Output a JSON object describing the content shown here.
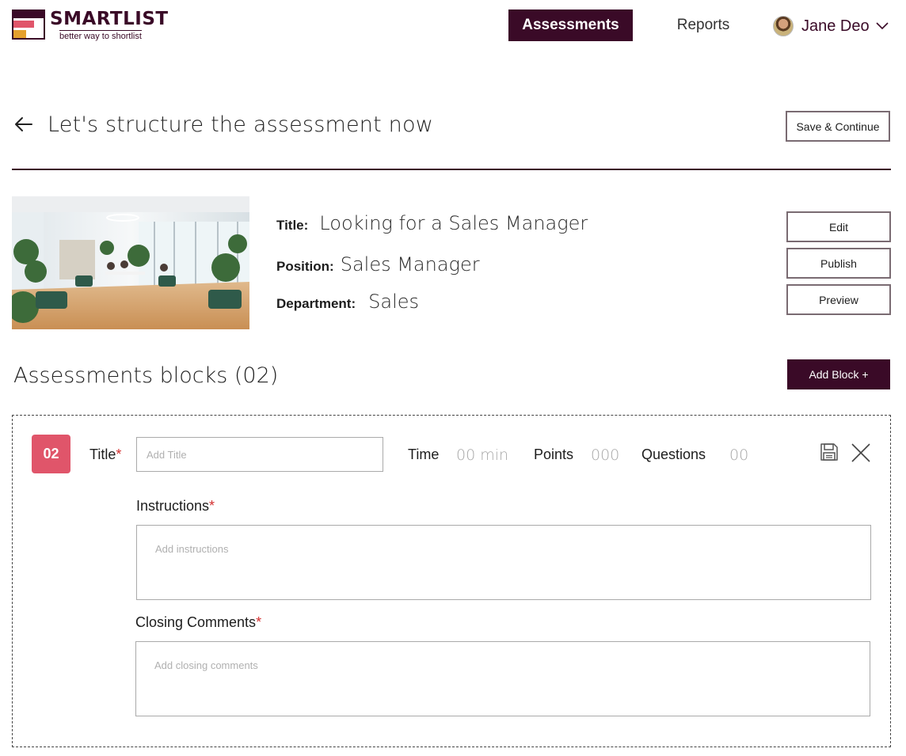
{
  "brand": {
    "name": "SMARTLIST",
    "tagline": "better way to shortlist",
    "primary_color": "#3a0a27",
    "accent_color": "#e0556a",
    "secondary_accent": "#e5a02d"
  },
  "nav": {
    "active": "Assessments",
    "reports": "Reports",
    "user_name": "Jane Deo"
  },
  "page": {
    "title": "Let's structure the assessment now",
    "save_continue": "Save & Continue"
  },
  "assessment": {
    "title_label": "Title:",
    "title_value": "Looking for a Sales Manager",
    "position_label": "Position:",
    "position_value": "Sales Manager",
    "department_label": "Department:",
    "department_value": "Sales",
    "actions": {
      "edit": "Edit",
      "publish": "Publish",
      "preview": "Preview"
    }
  },
  "blocks": {
    "heading": "Assessments blocks (02)",
    "add_button": "Add Block +",
    "block": {
      "number": "02",
      "title_label": "Title",
      "title_placeholder": "Add Title",
      "time_label": "Time",
      "time_value": "00 min",
      "points_label": "Points",
      "points_value": "000",
      "questions_label": "Questions",
      "questions_value": "00",
      "instructions_label": "Instructions",
      "instructions_placeholder": "Add instructions",
      "closing_label": "Closing Comments",
      "closing_placeholder": "Add closing comments",
      "required_mark": "*"
    }
  }
}
